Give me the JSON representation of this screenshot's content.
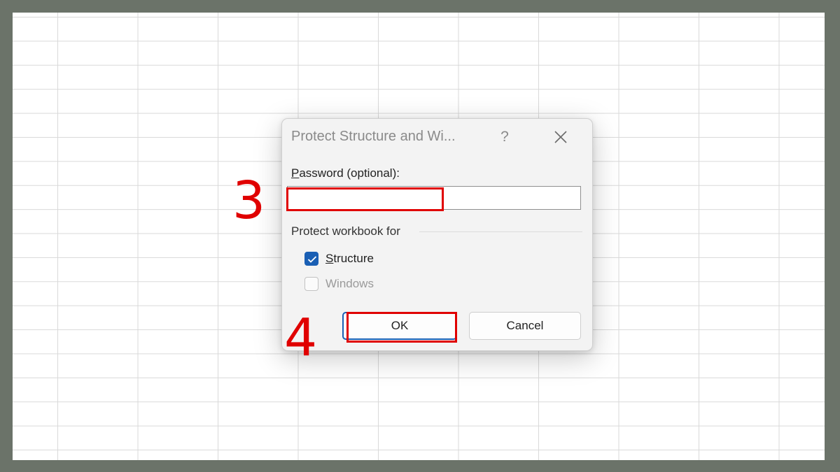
{
  "dialog": {
    "title": "Protect Structure and Wi...",
    "help_label": "?",
    "password_label_mnemonic": "P",
    "password_label_rest": "assword (optional):",
    "password_value": "",
    "group_label": "Protect workbook for",
    "structure_mnemonic": "S",
    "structure_rest": "tructure",
    "structure_checked": true,
    "windows_label": "Windows",
    "windows_checked": false,
    "ok_label": "OK",
    "cancel_label": "Cancel"
  },
  "annotations": {
    "step_password": "3",
    "step_ok": "4",
    "highlight_color": "#e00000"
  },
  "colors": {
    "accent": "#1a5fb4",
    "frame": "#6b7369"
  }
}
